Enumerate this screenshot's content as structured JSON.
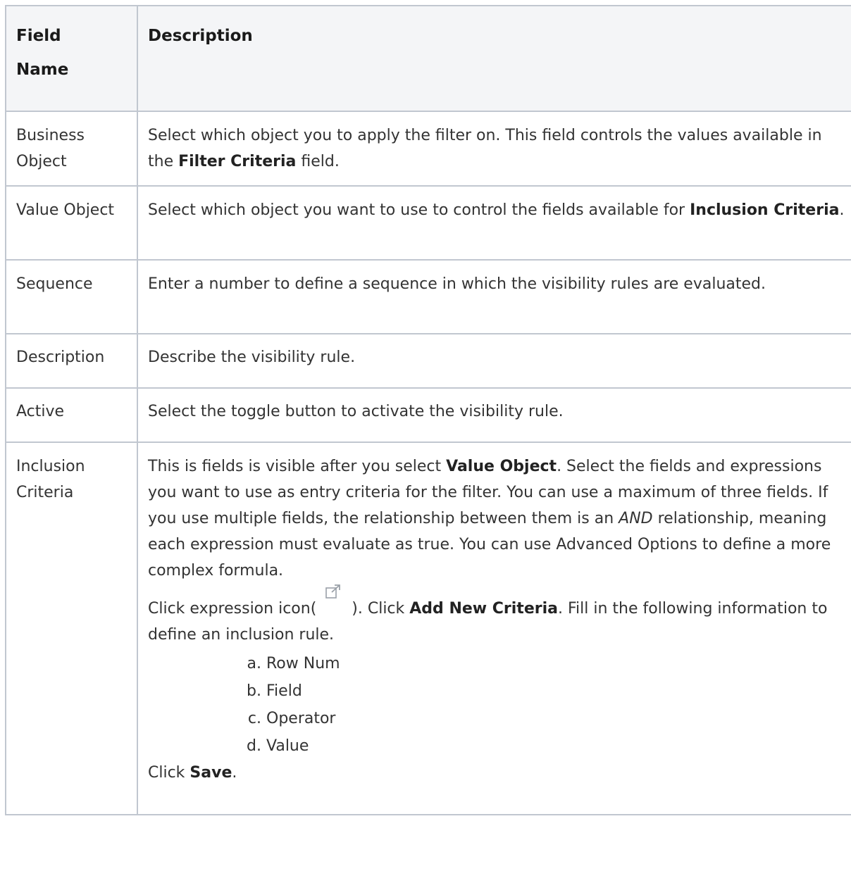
{
  "headers": {
    "field_name": "Field\nName",
    "description": "Description"
  },
  "rows": [
    {
      "field": "Business Object",
      "desc_pre": "Select which object you to apply the filter on. This field controls the values available in the ",
      "desc_bold": "Filter Criteria",
      "desc_post": " field."
    },
    {
      "field": "Value Object",
      "desc_pre": "Select which object you want to use to control the fields available for ",
      "desc_bold": "Inclusion Criteria",
      "desc_post": "."
    },
    {
      "field": "Sequence",
      "desc": "Enter a number to define a sequence in which the visibility rules are evaluated."
    },
    {
      "field": "Description",
      "desc": "Describe the visibility rule."
    },
    {
      "field": "Active",
      "desc": "Select the toggle button to activate the visibility rule."
    },
    {
      "field": "Inclusion Criteria",
      "p1_pre": "This is fields is visible after you select ",
      "p1_bold": "Value Object",
      "p1_mid": ". Select the fields and expressions you want to use as entry criteria for the filter. You can use a maximum of three fields. If you use multiple fields, the relationship between them is an ",
      "p1_ital": "AND",
      "p1_post": " relationship, meaning each expression must evaluate as true. You can use Advanced Options to define a more complex formula.",
      "p2_pre": "Click expression icon(",
      "p2_icon": "external-link-icon",
      "p2_mid": "). Click ",
      "p2_bold": "Add New Criteria",
      "p2_post": ". Fill in the following information to define an inclusion rule.",
      "steps": [
        {
          "marker": "a.",
          "text": "Row Num"
        },
        {
          "marker": "b.",
          "text": "Field"
        },
        {
          "marker": "c.",
          "text": "Operator"
        },
        {
          "marker": "d.",
          "text": "Value"
        }
      ],
      "final_pre": "Click ",
      "final_bold": "Save",
      "final_post": "."
    }
  ],
  "colors": {
    "border": "#c1c7d0",
    "header_bg": "#f4f5f7",
    "text": "#333333"
  }
}
